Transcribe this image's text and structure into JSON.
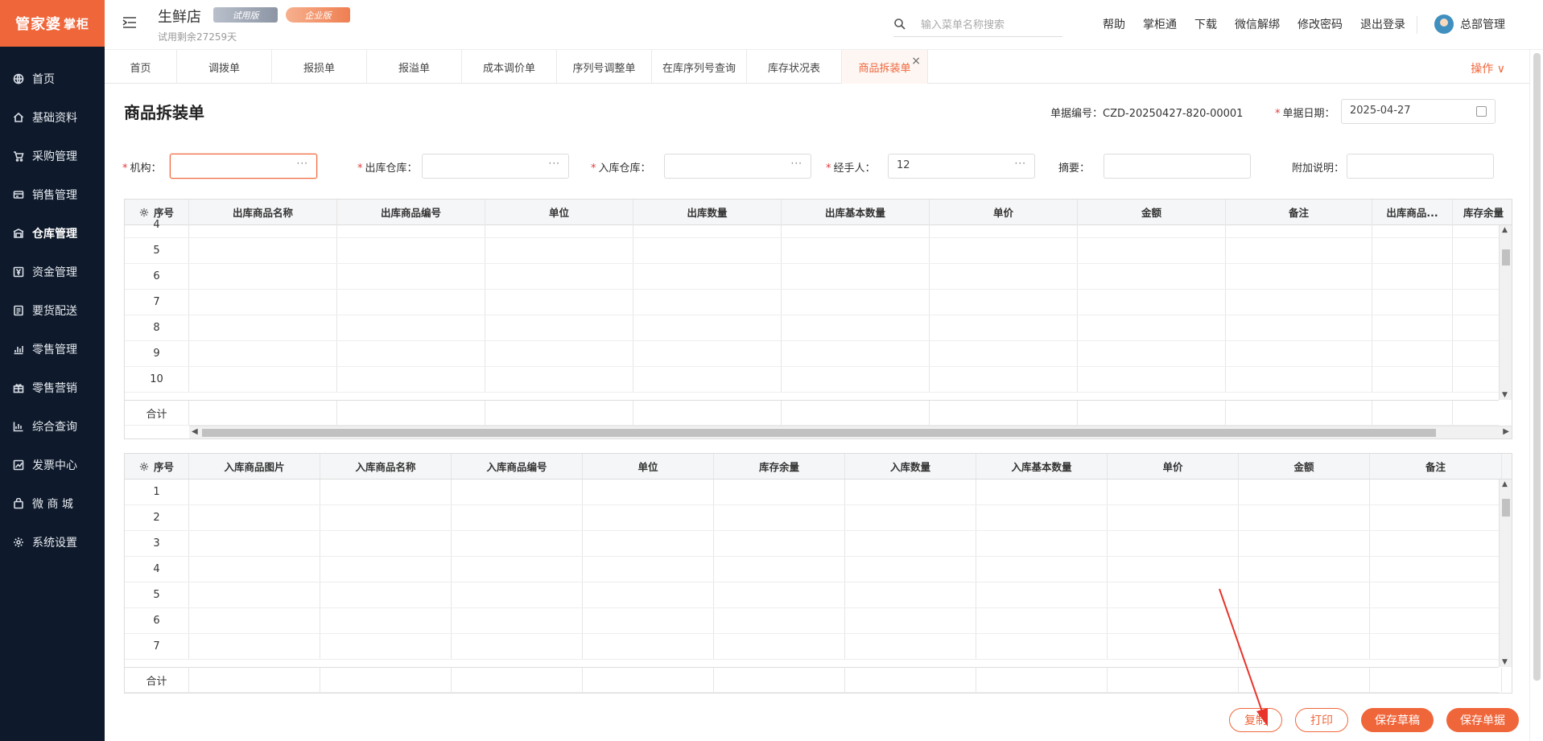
{
  "sidebar": {
    "logo_main": "管家婆",
    "logo_sub": "掌柜",
    "items": [
      {
        "label": "首页",
        "icon": "globe-icon"
      },
      {
        "label": "基础资料",
        "icon": "home-icon"
      },
      {
        "label": "采购管理",
        "icon": "cart-icon"
      },
      {
        "label": "销售管理",
        "icon": "card-icon"
      },
      {
        "label": "仓库管理",
        "icon": "warehouse-icon"
      },
      {
        "label": "资金管理",
        "icon": "yen-icon"
      },
      {
        "label": "要货配送",
        "icon": "list-icon"
      },
      {
        "label": "零售管理",
        "icon": "bar-chart-icon"
      },
      {
        "label": "零售营销",
        "icon": "gift-icon"
      },
      {
        "label": "综合查询",
        "icon": "chart-icon"
      },
      {
        "label": "发票中心",
        "icon": "trend-icon"
      },
      {
        "label": "微 商 城",
        "icon": "bag-icon"
      },
      {
        "label": "系统设置",
        "icon": "gear-icon"
      }
    ],
    "active_index": 4
  },
  "header": {
    "store_name": "生鲜店",
    "trial_text": "试用剩余27259天",
    "badge_trial": "试用版",
    "badge_enterprise": "企业版",
    "search_placeholder": "输入菜单名称搜索",
    "links": [
      "帮助",
      "掌柜通",
      "下载",
      "微信解绑",
      "修改密码",
      "退出登录"
    ],
    "user_name": "总部管理"
  },
  "tabs": {
    "items": [
      "首页",
      "调拨单",
      "报损单",
      "报溢单",
      "成本调价单",
      "序列号调整单",
      "在库序列号查询",
      "库存状况表",
      "商品拆装单"
    ],
    "active_index": 8,
    "ops_label": "操作 ∨"
  },
  "form": {
    "title": "商品拆装单",
    "docno_label": "单据编号：",
    "docno_value": "CZD-20250427-820-00001",
    "date_label": "单据日期：",
    "date_value": "2025-04-27",
    "org_label": "机构：",
    "out_wh_label": "出库仓库：",
    "in_wh_label": "入库仓库：",
    "handler_label": "经手人：",
    "handler_value": "12",
    "summary_label": "摘要：",
    "note_label": "附加说明：",
    "dots": "···"
  },
  "out_table": {
    "columns": [
      "序号",
      "出库商品名称",
      "出库商品编号",
      "单位",
      "出库数量",
      "出库基本数量",
      "单价",
      "金额",
      "备注",
      "出库商品...",
      "库存余量"
    ],
    "rows": [
      "4",
      "5",
      "6",
      "7",
      "8",
      "9",
      "10"
    ],
    "total_label": "合计"
  },
  "in_table": {
    "columns": [
      "序号",
      "入库商品图片",
      "入库商品名称",
      "入库商品编号",
      "单位",
      "库存余量",
      "入库数量",
      "入库基本数量",
      "单价",
      "金额",
      "备注"
    ],
    "rows": [
      "1",
      "2",
      "3",
      "4",
      "5",
      "6",
      "7"
    ],
    "total_label": "合计"
  },
  "buttons": {
    "copy": "复制",
    "print": "打印",
    "save_draft": "保存草稿",
    "save_doc": "保存单据"
  },
  "colors": {
    "accent": "#f0663b",
    "sidebar_bg": "#0e1a2b",
    "annotation_arrow": "#e8342a"
  }
}
